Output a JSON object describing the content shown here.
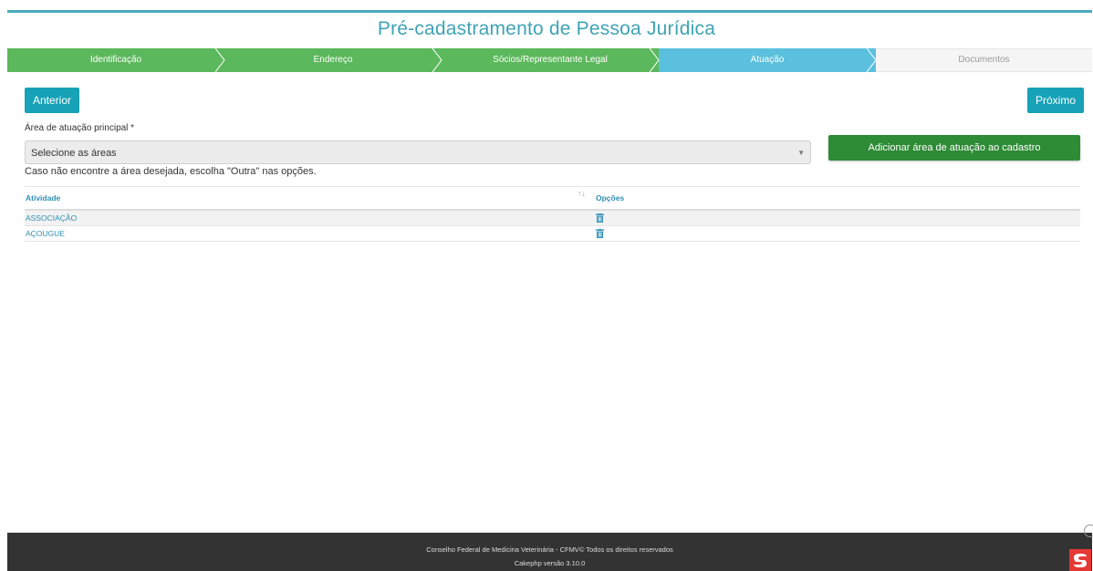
{
  "page": {
    "title": "Pré-cadastramento de Pessoa Jurídica"
  },
  "wizard": {
    "steps": [
      {
        "label": "Identificação",
        "state": "done"
      },
      {
        "label": "Endereço",
        "state": "done"
      },
      {
        "label": "Sócios/Representante Legal",
        "state": "done"
      },
      {
        "label": "Atuação",
        "state": "active"
      },
      {
        "label": "Documentos",
        "state": "todo"
      }
    ]
  },
  "nav": {
    "prev_label": "Anterior",
    "next_label": "Próximo"
  },
  "form": {
    "area_label": "Área de atuação principal *",
    "select_placeholder": "Selecione as áreas",
    "add_button_label": "Adicionar área de atuação ao cadastro",
    "hint": "Caso não encontre a área desejada, escolha \"Outra\" nas opções."
  },
  "table": {
    "columns": [
      "Atividade",
      "Opções"
    ],
    "sort_icon": "↑↓",
    "rows": [
      {
        "atividade": "ASSOCIAÇÃO",
        "option_icon": "trash-icon"
      },
      {
        "atividade": "AÇOUGUE",
        "option_icon": "trash-icon"
      }
    ]
  },
  "footer": {
    "line1": "Conselho Federal de Medicina Veterinária - CFMV© Todos os direitos reservados",
    "line2": "Cakephp versão 3.10.0"
  },
  "colors": {
    "step_done": "#5cb85c",
    "step_active": "#5bc0de",
    "step_todo": "#f5f5f5",
    "primary": "#17a2b8",
    "add_button": "#2e8b36",
    "footer_bg": "#333333"
  }
}
